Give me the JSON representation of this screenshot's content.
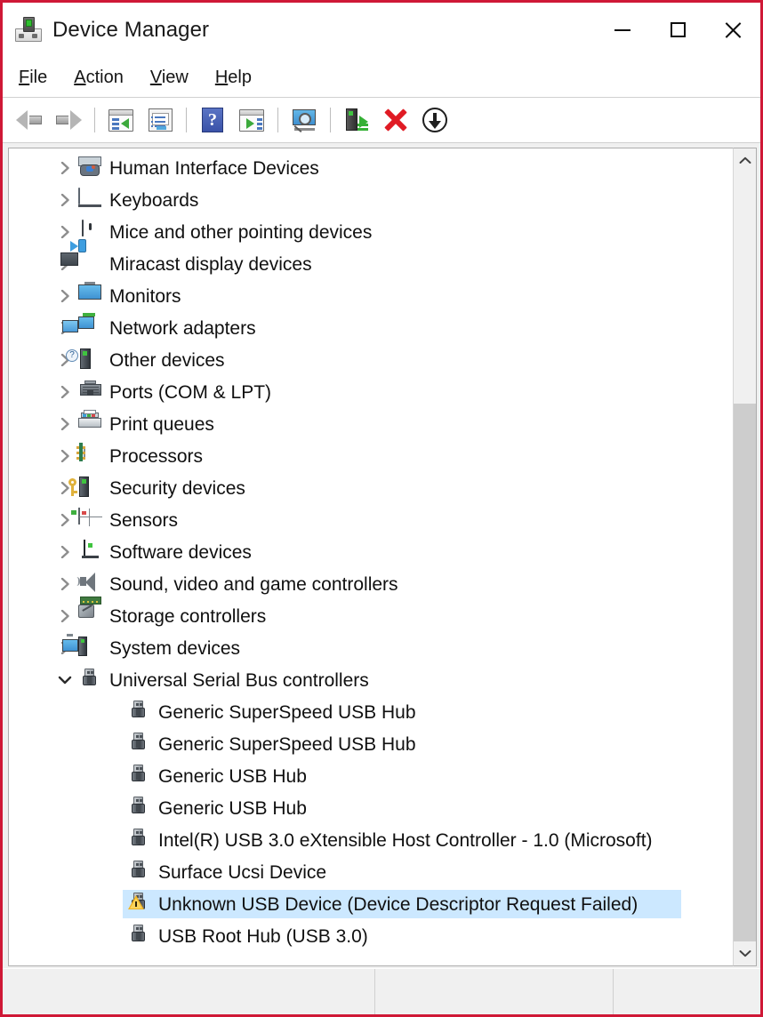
{
  "window": {
    "title": "Device Manager",
    "title_icon": "device-manager-icon",
    "accent_border_color": "#cf1836",
    "controls": {
      "minimize": "minimize-icon",
      "maximize": "maximize-icon",
      "close": "close-icon"
    }
  },
  "menubar": {
    "items": [
      {
        "accel": "F",
        "rest": "ile"
      },
      {
        "accel": "A",
        "rest": "ction"
      },
      {
        "accel": "V",
        "rest": "iew"
      },
      {
        "accel": "H",
        "rest": "elp"
      }
    ]
  },
  "toolbar": {
    "buttons": [
      {
        "name": "back-button",
        "icon": "back-arrow-icon"
      },
      {
        "name": "forward-button",
        "icon": "forward-arrow-icon"
      },
      {
        "name": "separator-1",
        "icon": "separator"
      },
      {
        "name": "show-hide-console-tree-button",
        "icon": "console-tree-icon"
      },
      {
        "name": "properties-button",
        "icon": "properties-icon"
      },
      {
        "name": "separator-2",
        "icon": "separator"
      },
      {
        "name": "help-button",
        "icon": "help-question-icon"
      },
      {
        "name": "update-driver-button",
        "icon": "update-driver-window-icon"
      },
      {
        "name": "separator-3",
        "icon": "separator"
      },
      {
        "name": "scan-for-hardware-changes-button",
        "icon": "scan-hardware-icon"
      },
      {
        "name": "separator-4",
        "icon": "separator"
      },
      {
        "name": "enable-device-button",
        "icon": "enable-device-icon"
      },
      {
        "name": "uninstall-device-button",
        "icon": "red-x-icon"
      },
      {
        "name": "install-legacy-hardware-button",
        "icon": "download-arrow-icon"
      }
    ]
  },
  "tree": {
    "selected_highlight_color": "#cce8ff",
    "items": [
      {
        "label": "Human Interface Devices",
        "icon": "hid-icon",
        "level": 0,
        "expander": "collapsed",
        "selected": false
      },
      {
        "label": "Keyboards",
        "icon": "keyboard-icon",
        "level": 0,
        "expander": "collapsed",
        "selected": false
      },
      {
        "label": "Mice and other pointing devices",
        "icon": "mouse-icon",
        "level": 0,
        "expander": "collapsed",
        "selected": false
      },
      {
        "label": "Miracast display devices",
        "icon": "miracast-icon",
        "level": 0,
        "expander": "collapsed",
        "selected": false
      },
      {
        "label": "Monitors",
        "icon": "monitor-icon",
        "level": 0,
        "expander": "collapsed",
        "selected": false
      },
      {
        "label": "Network adapters",
        "icon": "network-adapter-icon",
        "level": 0,
        "expander": "collapsed",
        "selected": false
      },
      {
        "label": "Other devices",
        "icon": "other-devices-icon",
        "level": 0,
        "expander": "collapsed",
        "selected": false
      },
      {
        "label": "Ports (COM & LPT)",
        "icon": "port-icon",
        "level": 0,
        "expander": "collapsed",
        "selected": false
      },
      {
        "label": "Print queues",
        "icon": "printer-icon",
        "level": 0,
        "expander": "collapsed",
        "selected": false
      },
      {
        "label": "Processors",
        "icon": "processor-icon",
        "level": 0,
        "expander": "collapsed",
        "selected": false
      },
      {
        "label": "Security devices",
        "icon": "security-device-icon",
        "level": 0,
        "expander": "collapsed",
        "selected": false
      },
      {
        "label": "Sensors",
        "icon": "sensor-icon",
        "level": 0,
        "expander": "collapsed",
        "selected": false
      },
      {
        "label": "Software devices",
        "icon": "software-device-icon",
        "level": 0,
        "expander": "collapsed",
        "selected": false
      },
      {
        "label": "Sound, video and game controllers",
        "icon": "speaker-icon",
        "level": 0,
        "expander": "collapsed",
        "selected": false
      },
      {
        "label": "Storage controllers",
        "icon": "storage-controller-icon",
        "level": 0,
        "expander": "collapsed",
        "selected": false
      },
      {
        "label": "System devices",
        "icon": "system-device-icon",
        "level": 0,
        "expander": "collapsed",
        "selected": false
      },
      {
        "label": "Universal Serial Bus controllers",
        "icon": "usb-icon",
        "level": 0,
        "expander": "expanded",
        "selected": false
      },
      {
        "label": "Generic SuperSpeed USB Hub",
        "icon": "usb-icon",
        "level": 1,
        "expander": "none",
        "selected": false
      },
      {
        "label": "Generic SuperSpeed USB Hub",
        "icon": "usb-icon",
        "level": 1,
        "expander": "none",
        "selected": false
      },
      {
        "label": "Generic USB Hub",
        "icon": "usb-icon",
        "level": 1,
        "expander": "none",
        "selected": false
      },
      {
        "label": "Generic USB Hub",
        "icon": "usb-icon",
        "level": 1,
        "expander": "none",
        "selected": false
      },
      {
        "label": "Intel(R) USB 3.0 eXtensible Host Controller - 1.0 (Microsoft)",
        "icon": "usb-icon",
        "level": 1,
        "expander": "none",
        "selected": false
      },
      {
        "label": "Surface Ucsi Device",
        "icon": "usb-icon",
        "level": 1,
        "expander": "none",
        "selected": false
      },
      {
        "label": "Unknown USB Device (Device Descriptor Request Failed)",
        "icon": "usb-warning-icon",
        "level": 1,
        "expander": "none",
        "selected": true
      },
      {
        "label": "USB Root Hub (USB 3.0)",
        "icon": "usb-icon",
        "level": 1,
        "expander": "none",
        "selected": false
      }
    ]
  },
  "scrollbar": {
    "up_button": "scroll-up-icon",
    "down_button": "scroll-down-icon",
    "thumb_top_pct": 30,
    "thumb_height_pct": 70
  },
  "statusbar": {
    "pane1": "",
    "pane2": "",
    "pane3": ""
  }
}
